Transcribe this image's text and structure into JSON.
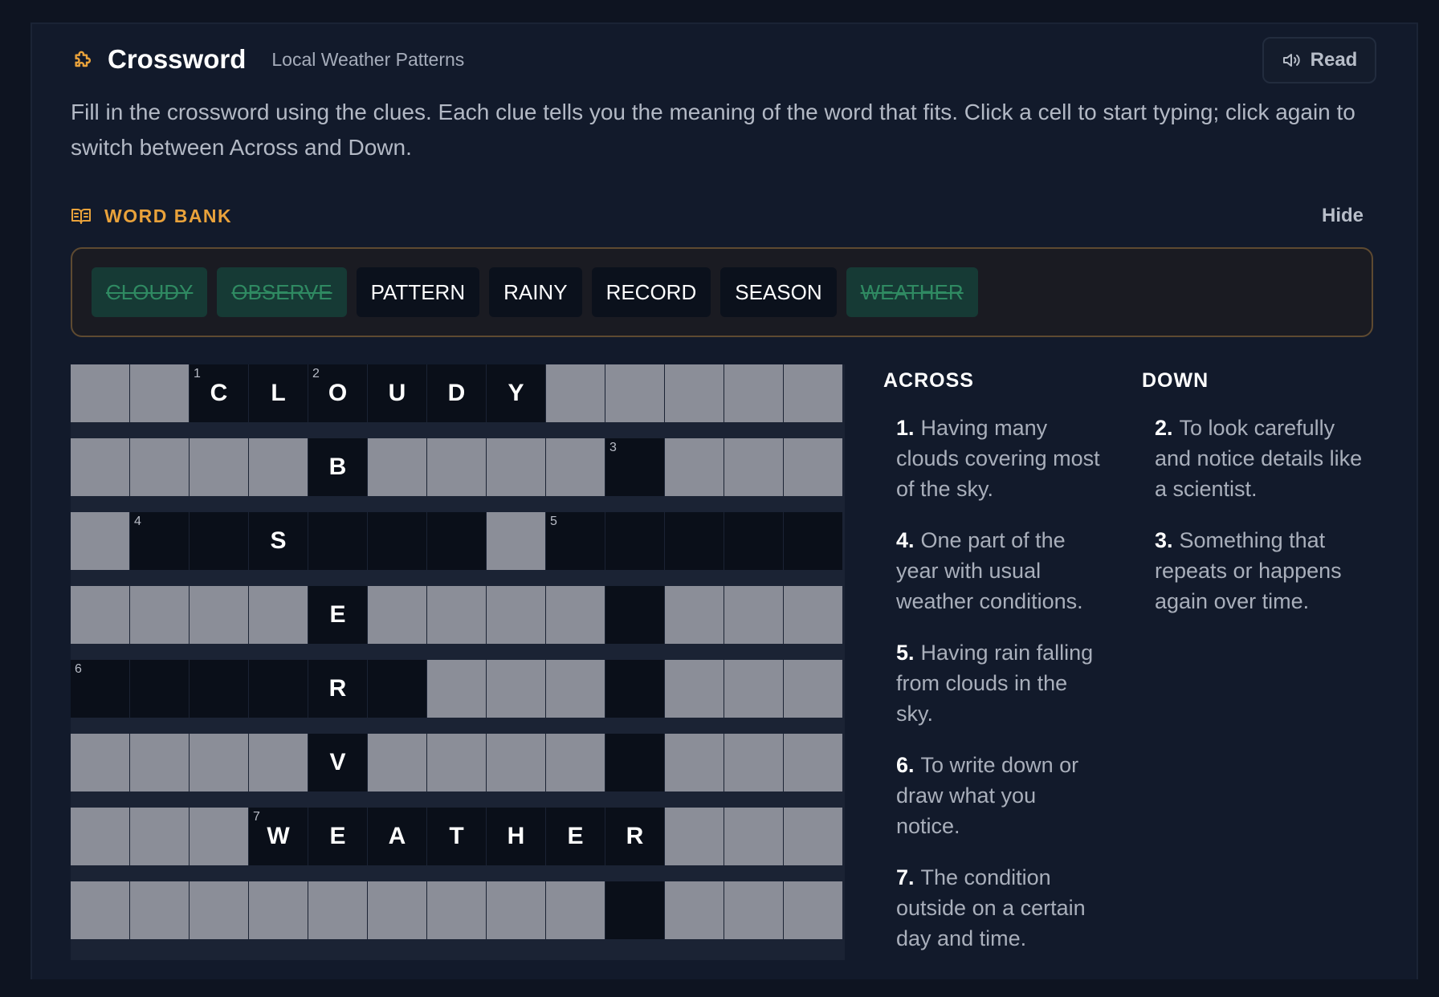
{
  "header": {
    "title": "Crossword",
    "subtitle": "Local Weather Patterns",
    "read_label": "Read"
  },
  "instructions": "Fill in the crossword using the clues. Each clue tells you the meaning of the word that fits. Click a cell to start typing; click again to switch between Across and Down.",
  "word_bank": {
    "title": "WORD BANK",
    "hide_label": "Hide",
    "words": [
      {
        "word": "CLOUDY",
        "used": true
      },
      {
        "word": "OBSERVE",
        "used": true
      },
      {
        "word": "PATTERN",
        "used": false
      },
      {
        "word": "RAINY",
        "used": false
      },
      {
        "word": "RECORD",
        "used": false
      },
      {
        "word": "SEASON",
        "used": false
      },
      {
        "word": "WEATHER",
        "used": true
      }
    ]
  },
  "grid": {
    "rows": [
      "##CLOUDY#####",
      "####B####.###",
      "#..S...#.....",
      "####E####.###",
      "....R.###.###",
      "####V####.###",
      "###WEATHER###",
      "#########.###"
    ],
    "numbers": [
      {
        "row": 0,
        "col": 2,
        "n": "1"
      },
      {
        "row": 0,
        "col": 4,
        "n": "2"
      },
      {
        "row": 1,
        "col": 9,
        "n": "3"
      },
      {
        "row": 2,
        "col": 1,
        "n": "4"
      },
      {
        "row": 2,
        "col": 8,
        "n": "5"
      },
      {
        "row": 4,
        "col": 0,
        "n": "6"
      },
      {
        "row": 6,
        "col": 3,
        "n": "7"
      }
    ]
  },
  "clues": {
    "across_title": "ACROSS",
    "down_title": "DOWN",
    "across": [
      {
        "num": "1.",
        "text": "Having many clouds covering most of the sky."
      },
      {
        "num": "4.",
        "text": "One part of the year with usual weather conditions."
      },
      {
        "num": "5.",
        "text": "Having rain falling from clouds in the sky."
      },
      {
        "num": "6.",
        "text": "To write down or draw what you notice."
      },
      {
        "num": "7.",
        "text": "The condition outside on a certain day and time."
      }
    ],
    "down": [
      {
        "num": "2.",
        "text": "To look carefully and notice details like a scientist."
      },
      {
        "num": "3.",
        "text": "Something that repeats or happens again over time."
      }
    ]
  }
}
